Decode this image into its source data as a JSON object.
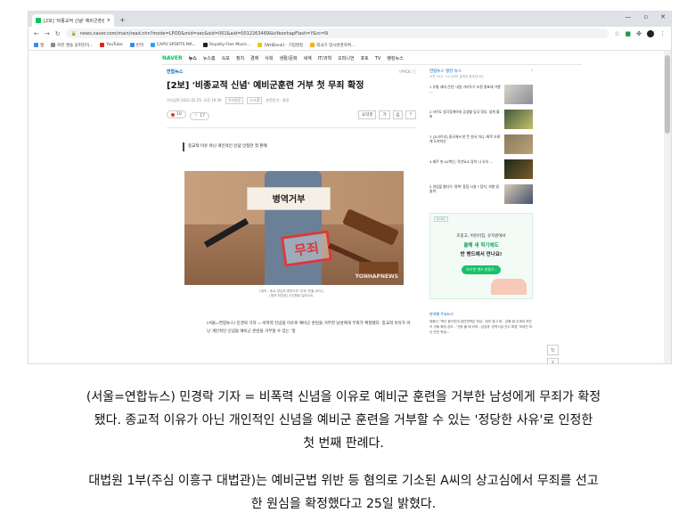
{
  "browser": {
    "tab_title": "[2보] '비종교적 신념' 예비군훈련 ...",
    "window_controls": [
      "—",
      "▫",
      "✕"
    ],
    "new_tab": "+",
    "url": "news.naver.com/main/read.nhn?mode=LPOD&mid=sec&oid=001&aid=0012263469&isYeonhapFlash=Y&rc=N",
    "bookmarks": [
      "앱",
      "커뮤 헨들 옹퍼진이...",
      "YouTube",
      "번역",
      "CAPO SPORTS MA...",
      "Royalty-Free Music...",
      "[WHBank] - 기업명칭",
      "외국기 일시변경하여..."
    ]
  },
  "gnb": {
    "logo": "NAVER",
    "section": "뉴스",
    "items": [
      "뉴스홈",
      "속보",
      "정치",
      "경제",
      "사회",
      "생활/문화",
      "세계",
      "IT/과학",
      "오피니언",
      "포토",
      "TV",
      "랭킹뉴스"
    ]
  },
  "article": {
    "press": "연합뉴스",
    "press_right": "▽PICK ⓘ",
    "headline": "[2보] '비종교적 신념' 예비군훈련 거부 첫 무죄 확정",
    "date": "기사입력 2021.02.25. 오전 10:39",
    "tags": [
      "기사원문",
      "스크랩"
    ],
    "reporter": "본문듣기 · 설정",
    "reaction_like": "10",
    "reaction_comment": "17",
    "tools": [
      "요약봇",
      "가",
      "⎙",
      "⇪"
    ],
    "summary": "종교적 이유 아닌 개인적인 신념 인정한 첫 판례",
    "photo_sign": "병역거부",
    "photo_stamp": "무죄",
    "photo_watermark": "YONHAPNEWS",
    "caption_1": "[제작 : 종교 양심적 병역거부 '무죄' 판결 (PG)]",
    "caption_2": "[제작 최진영] 사진합성 일러스트",
    "body": "(서울=연합뉴스) 민경락 기자 = 비폭력 신념을 이유로 예비군 훈련을 거부한 남성에게 무죄가 확정됐다. 종교적 이유가 아닌 개인적인 신념을 예비군 훈련을 거부할 수 있는 '정"
  },
  "sidebar": {
    "title": "연합뉴스 랭킹 뉴스",
    "subtitle": "오전 10시~11시까지 집계한 결과입니다.",
    "more": "›",
    "items": [
      {
        "text": "1 유통 세대 간판, 내일 거리두기 조정 발표에 가행 ..."
      },
      {
        "text": "2 서이도 청각장애아와 공생할 입국 정부, 생계 활비"
      },
      {
        "text": "3 [쇼크트리] 중국에서 한 뜬 한국 차니..화학 조례에 도착하신"
      },
      {
        "text": "4 제주 첫 AZ백신, 작년요소 맞아 나 유리 ..."
      },
      {
        "text": "5 영업을 했다가 '정책' 중점 시설 ? 탐지, 처벌 말들까"
      }
    ],
    "ad": {
      "label": "BAND",
      "line1": "초중고, 어린이집, 유치원에서",
      "line2": "올해 새 학기에도",
      "line3": "반 밴드에서 만나요!",
      "cta": "우리 반 밴드 만들기 ›"
    },
    "news_title": "분야별 주요뉴스",
    "news_text": "정봉신 \"백신 음식인데 집단면역은 허상.. 정부 광고 한.. 김행 점 신세대 곡안 카 규들 확립 강조.. '규정 불 에 리하.. 임성과 '압력시킬 선수 특정' 보내인 대신 반전 학생..."
  },
  "floating": {
    "refresh_label": "↻",
    "top_label": "⊼"
  },
  "caption_below": {
    "para1_line1": "(서울=연합뉴스) 민경락 기자 = 비폭력 신념을 이유로 예비군 훈련을 거부한 남성에게 무죄가 확정",
    "para1_line2": "됐다. 종교적 이유가 아닌 개인적인 신념을 예비군 훈련을 거부할 수 있는 '정당한 사유'로 인정한",
    "para1_line3": "첫 번째 판례다.",
    "para2_line1": "대법원 1부(주심 이흥구 대법관)는 예비군법 위반 등 혐의로 기소된 A씨의 상고심에서 무죄를 선고",
    "para2_line2": "한 원심을 확정했다고 25일 밝혔다."
  }
}
